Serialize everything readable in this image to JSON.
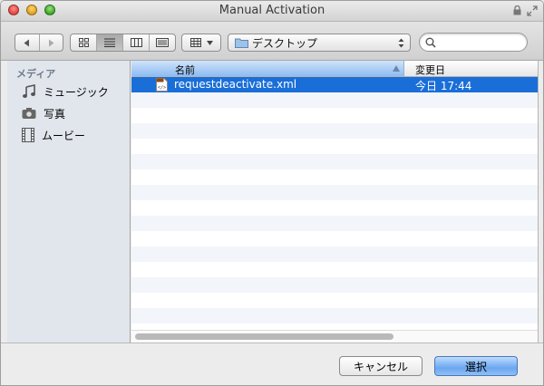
{
  "window": {
    "title": "Manual Activation"
  },
  "toolbar": {
    "location": "デスクトップ",
    "search_placeholder": ""
  },
  "sidebar": {
    "heading": "メディア",
    "items": [
      {
        "label": "ミュージック",
        "icon": "music-note-icon"
      },
      {
        "label": "写真",
        "icon": "camera-icon"
      },
      {
        "label": "ムービー",
        "icon": "film-icon"
      }
    ]
  },
  "filelist": {
    "columns": {
      "name": "名前",
      "date": "変更日"
    },
    "rows": [
      {
        "name": "requestdeactivate.xml",
        "date": "今日 17:44",
        "selected": true
      }
    ]
  },
  "buttons": {
    "cancel": "キャンセル",
    "choose": "選択"
  },
  "colors": {
    "selection": "#1a6ed8",
    "sidebar": "#e1e6ed",
    "accent": "#6aa7f0"
  }
}
